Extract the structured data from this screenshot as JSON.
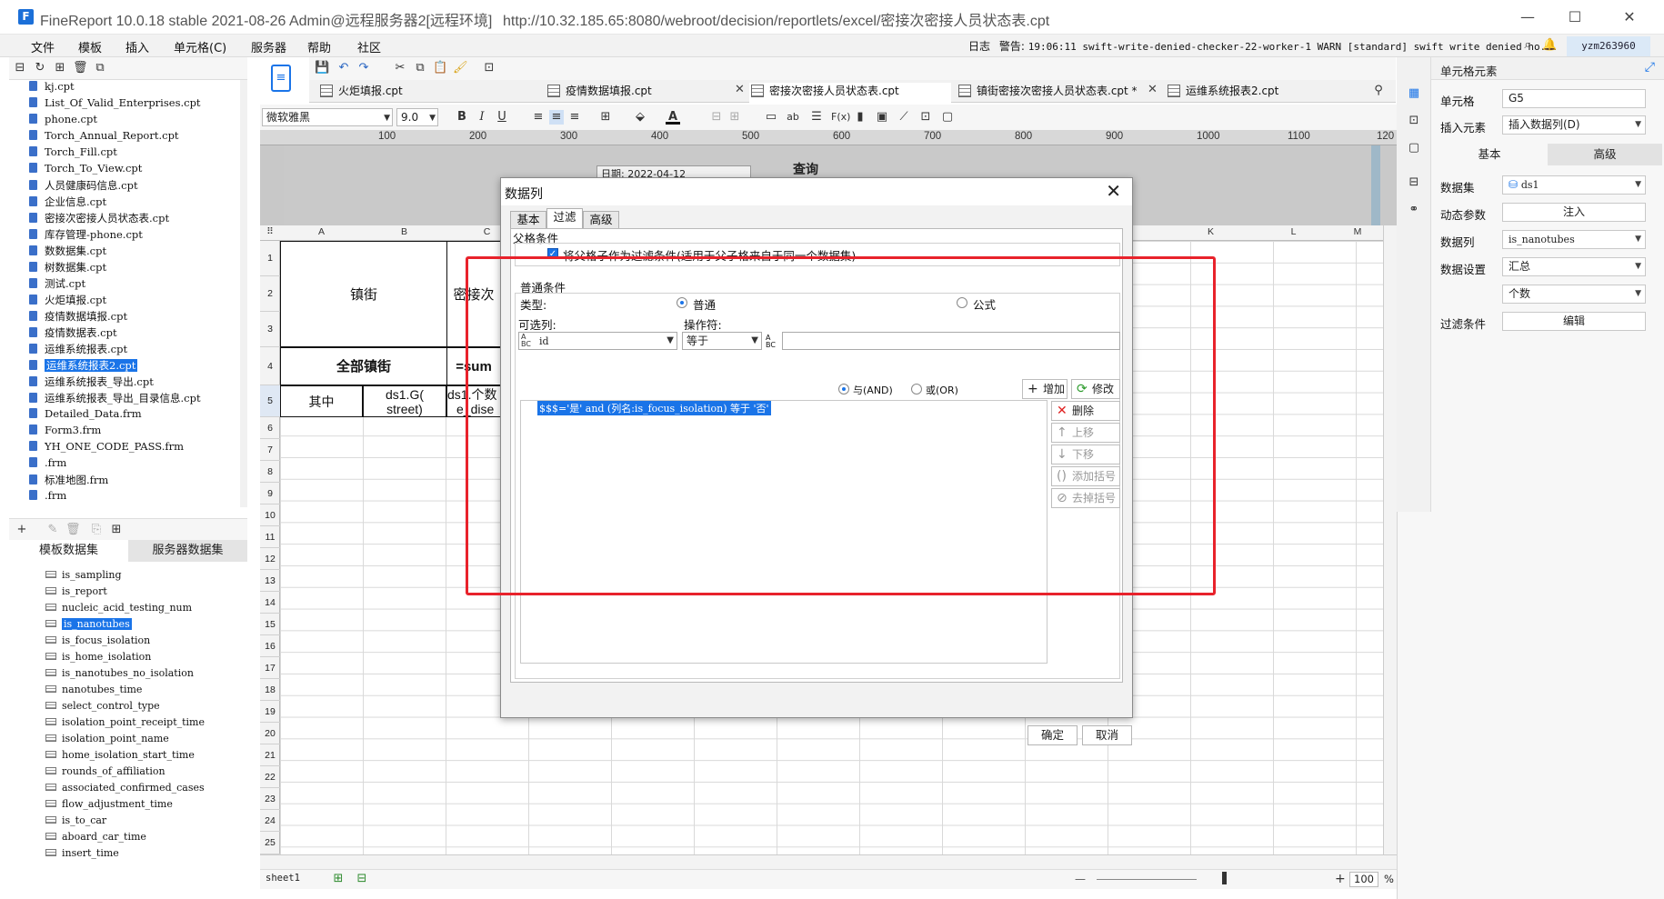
{
  "window": {
    "app_title": "FineReport 10.0.18 stable 2021-08-26 Admin@远程服务器2[远程环境]",
    "url": "http://10.32.185.65:8080/webroot/decision/reportlets/excel/密接次密接人员状态表.cpt",
    "minimize": "—",
    "maximize": "☐",
    "close": "✕"
  },
  "menu": [
    "文件",
    "模板",
    "插入",
    "单元格(C)",
    "服务器",
    "帮助",
    "社区"
  ],
  "logbar": {
    "log_label": "日志",
    "warn_label": "警告:",
    "warn_text": "19:06:11 swift-write-denied-checker-22-worker-1 WARN [standard] swift write denied ho...",
    "user": "yzm263960"
  },
  "file_tree": [
    {
      "name": "kj.cpt"
    },
    {
      "name": "List_Of_Valid_Enterprises.cpt"
    },
    {
      "name": "phone.cpt"
    },
    {
      "name": "Torch_Annual_Report.cpt"
    },
    {
      "name": "Torch_Fill.cpt"
    },
    {
      "name": "Torch_To_View.cpt"
    },
    {
      "name": "人员健康码信息.cpt"
    },
    {
      "name": "企业信息.cpt"
    },
    {
      "name": "密接次密接人员状态表.cpt"
    },
    {
      "name": "库存管理-phone.cpt"
    },
    {
      "name": "数数据集.cpt"
    },
    {
      "name": "树数据集.cpt"
    },
    {
      "name": "测试.cpt"
    },
    {
      "name": "火炬填报.cpt"
    },
    {
      "name": "疫情数据填报.cpt"
    },
    {
      "name": "疫情数据表.cpt"
    },
    {
      "name": "运维系统报表.cpt"
    },
    {
      "name": "运维系统报表2.cpt",
      "selected": true
    },
    {
      "name": "运维系统报表_导出.cpt"
    },
    {
      "name": "运维系统报表_导出_目录信息.cpt"
    },
    {
      "name": "Detailed_Data.frm"
    },
    {
      "name": "Form3.frm"
    },
    {
      "name": "YH_ONE_CODE_PASS.frm"
    },
    {
      "name": ".frm"
    },
    {
      "name": "标准地图.frm"
    },
    {
      "name": ".frm"
    }
  ],
  "dataset_tabs": {
    "template": "模板数据集",
    "server": "服务器数据集"
  },
  "fields": [
    "is_sampling",
    "is_report",
    "nucleic_acid_testing_num",
    "is_nanotubes",
    "is_focus_isolation",
    "is_home_isolation",
    "is_nanotubes_no_isolation",
    "nanotubes_time",
    "select_control_type",
    "isolation_point_receipt_time",
    "isolation_point_name",
    "home_isolation_start_time",
    "rounds_of_affiliation",
    "associated_confirmed_cases",
    "flow_adjustment_time",
    "is_to_car",
    "aboard_car_time",
    "insert_time"
  ],
  "selected_field": "is_nanotubes",
  "doc_tabs": [
    {
      "label": "火炬填报.cpt"
    },
    {
      "label": "疫情数据填报.cpt"
    },
    {
      "label": "密接次密接人员状态表.cpt",
      "active": true
    },
    {
      "label": "镇街密接次密接人员状态表.cpt *"
    },
    {
      "label": "运维系统报表2.cpt"
    }
  ],
  "format": {
    "font": "微软雅黑",
    "size": "9.0"
  },
  "ruler": [
    "100",
    "200",
    "300",
    "400",
    "500",
    "600",
    "700",
    "800",
    "900",
    "1000",
    "1100",
    "120"
  ],
  "canvas": {
    "date_label": "日期:",
    "date_value": "2022-04-12",
    "query": "查询"
  },
  "columns": [
    "A",
    "B",
    "C",
    "K",
    "L",
    "M"
  ],
  "rows": [
    "1",
    "2",
    "3",
    "4",
    "5",
    "6",
    "7",
    "8",
    "9",
    "10",
    "11",
    "12",
    "13",
    "14",
    "15",
    "16",
    "17",
    "18",
    "19",
    "20",
    "21",
    "22",
    "23",
    "24",
    "25"
  ],
  "cells": {
    "a1": "镇街",
    "c1": "密接次",
    "a4": "全部镇街",
    "c4": "=sum",
    "a5": "其中",
    "b5_1": "ds1.G(",
    "b5_2": "street)",
    "c5_1": "ds1.个数",
    "c5_2": "e_dise"
  },
  "sheet": {
    "name": "sheet1",
    "zoom": "100",
    "pct": "%"
  },
  "right_panel": {
    "title": "单元格元素",
    "cell_label": "单元格",
    "cell_value": "G5",
    "insert_label": "插入元素",
    "insert_value": "插入数据列(D)",
    "tab_basic": "基本",
    "tab_advanced": "高级",
    "dataset_label": "数据集",
    "dataset_value": "ds1",
    "dynamic_label": "动态参数",
    "dynamic_btn": "注入",
    "column_label": "数据列",
    "column_value": "is_nanotubes",
    "setting_label": "数据设置",
    "setting_value": "汇总",
    "agg_value": "个数",
    "filter_label": "过滤条件",
    "filter_btn": "编辑"
  },
  "dialog": {
    "title": "数据列",
    "tabs": [
      "基本",
      "过滤",
      "高级"
    ],
    "active_tab": "过滤",
    "parent_section": "父格条件",
    "parent_checkbox": "将父格子作为过滤条件(适用于父子格来自于同一个数据集)",
    "normal_section": "普通条件",
    "type_label": "类型:",
    "type_normal": "普通",
    "type_formula": "公式",
    "column_label": "可选列:",
    "operator_label": "操作符:",
    "column_value": "id",
    "operator_value": "等于",
    "value_input": "",
    "and_label": "与(AND)",
    "or_label": "或(OR)",
    "add_btn": "增加",
    "modify_btn": "修改",
    "delete_btn": "删除",
    "up_btn": "上移",
    "down_btn": "下移",
    "add_paren_btn": "添加括号",
    "remove_paren_btn": "去掉括号",
    "condition": "$$$='是' and (列名:is_focus_isolation) 等于 '否'",
    "ok": "确定",
    "cancel": "取消"
  },
  "colors": {
    "accent": "#1a74e8",
    "highlight_border": "#e8222b"
  }
}
